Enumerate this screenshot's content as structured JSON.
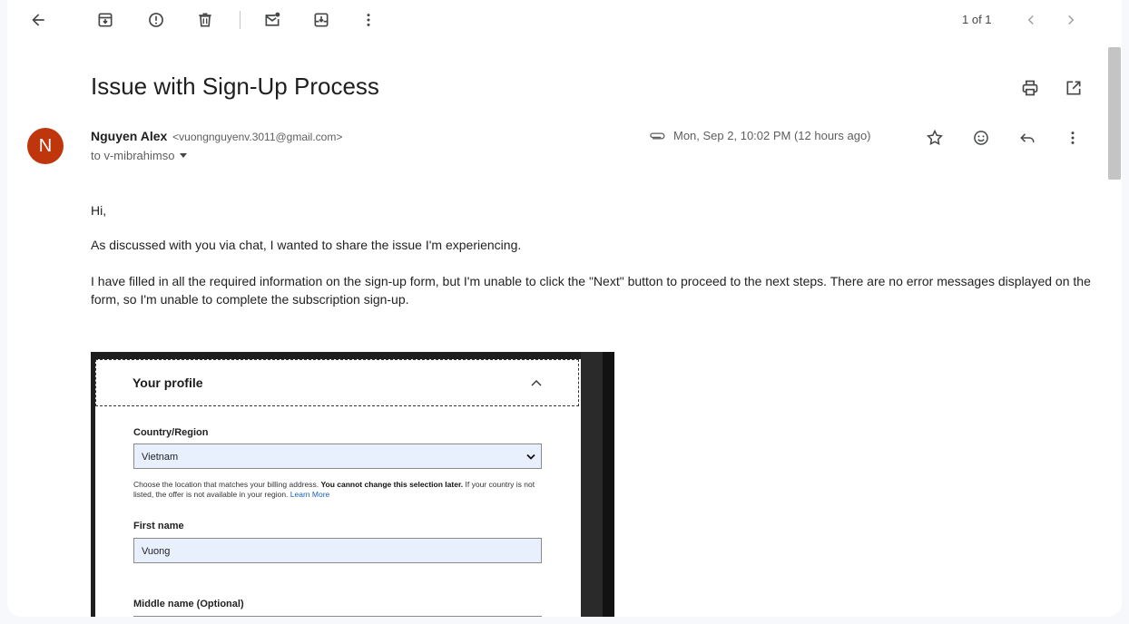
{
  "toolbar": {
    "icons": [
      "back-arrow-icon",
      "archive-icon",
      "report-spam-icon",
      "delete-icon",
      "mark-unread-icon",
      "snooze-icon",
      "more-vert-icon"
    ],
    "pager_text": "1 of 1",
    "prev_icon": "chevron-left-icon",
    "next_icon": "chevron-right-icon"
  },
  "email": {
    "subject": "Issue with Sign-Up Process",
    "avatar_letter": "N",
    "avatar_color": "#c0360c",
    "sender_name": "Nguyen Alex",
    "sender_email": "<vuongnguyenv.3011@gmail.com>",
    "recipient": "to v-mibrahimso",
    "date": "Mon, Sep 2, 10:02 PM (12 hours ago)",
    "body": {
      "greeting": "Hi,",
      "p1": "As discussed with you via chat, I wanted to share the issue I'm experiencing.",
      "p2": "I have filled in all the required information on the sign-up form, but I'm unable to click the \"Next\" button to proceed to the next steps. There are no error messages displayed on the form, so I'm unable to complete the subscription sign-up."
    }
  },
  "screenshot": {
    "section_title": "Your profile",
    "country_label": "Country/Region",
    "country_value": "Vietnam",
    "help_pre": "Choose the location that matches your billing address. ",
    "help_bold": "You cannot change this selection later.",
    "help_post": " If your country is not listed, the offer is not available in your region. ",
    "help_link": "Learn More",
    "first_name_label": "First name",
    "first_name_value": "Vuong",
    "middle_name_label": "Middle name (Optional)",
    "middle_name_value": ""
  }
}
